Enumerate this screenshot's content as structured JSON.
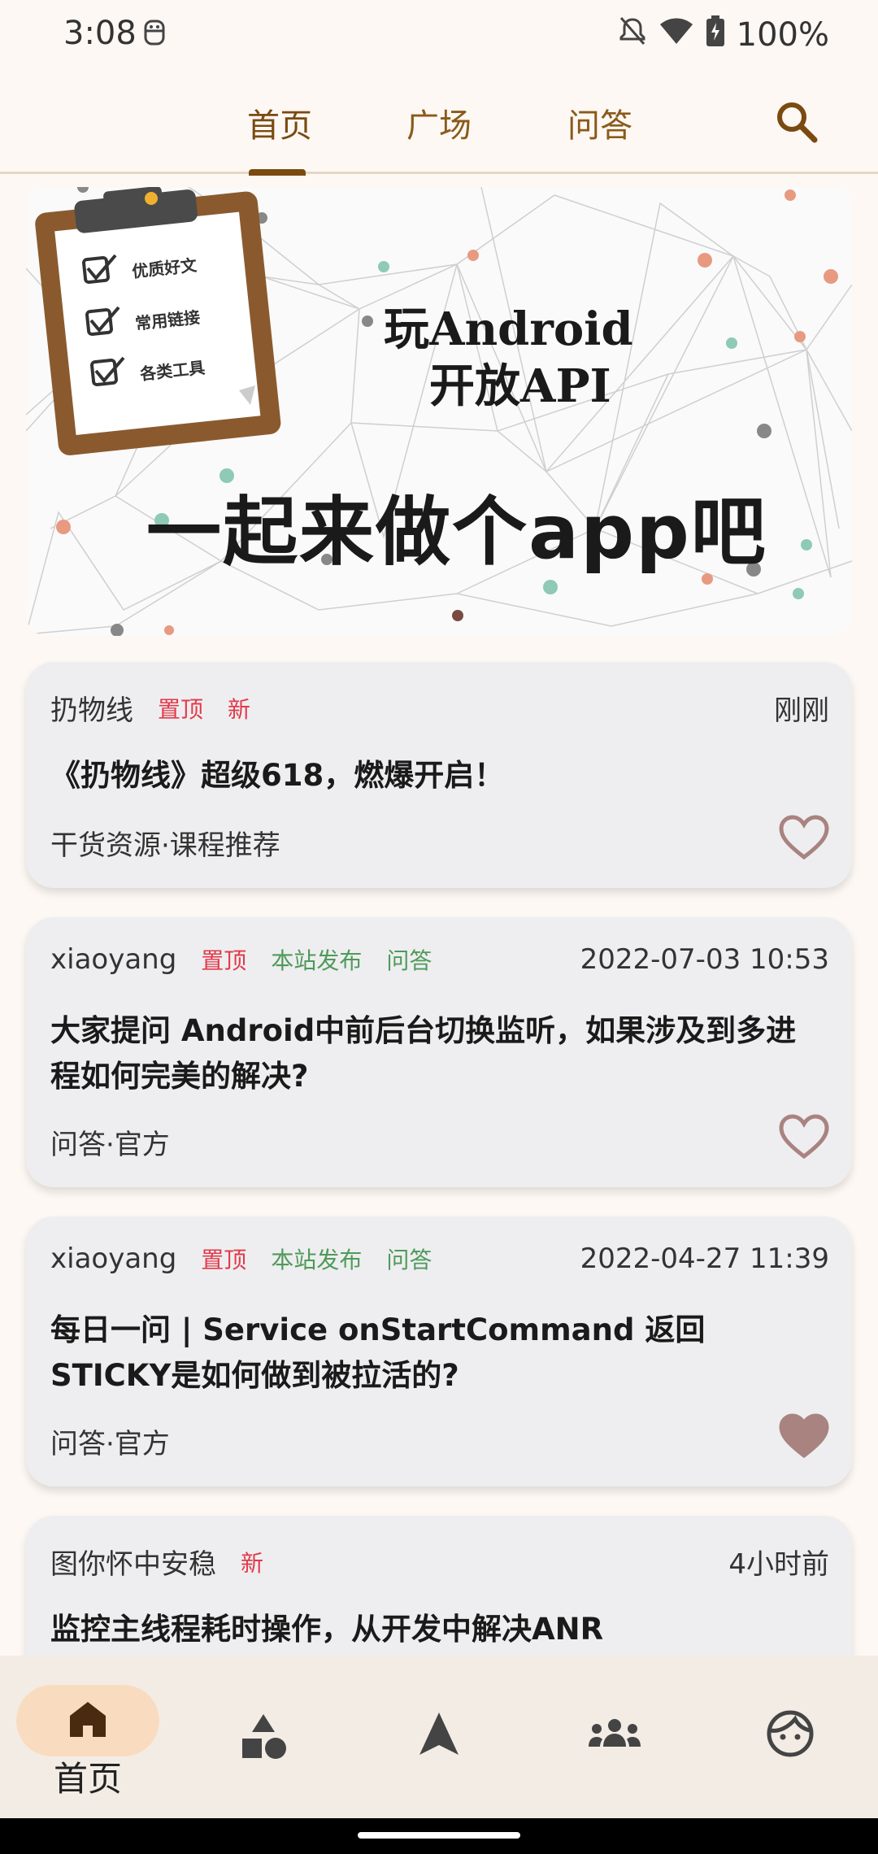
{
  "status": {
    "time": "3:08",
    "battery": "100%"
  },
  "tabs": [
    {
      "label": "首页",
      "active": true
    },
    {
      "label": "广场",
      "active": false
    },
    {
      "label": "问答",
      "active": false
    }
  ],
  "banner": {
    "line1": "玩Android",
    "line2": "开放API",
    "slogan": "一起来做个app吧",
    "clipboard": [
      "优质好文",
      "常用链接",
      "各类工具"
    ]
  },
  "cards": [
    {
      "author": "扔物线",
      "tags": [
        {
          "text": "置顶",
          "color": "red"
        },
        {
          "text": "新",
          "color": "red"
        }
      ],
      "time": "刚刚",
      "title": "《扔物线》超级618，燃爆开启！",
      "chapter": "干货资源·课程推荐",
      "liked": false
    },
    {
      "author": "xiaoyang",
      "tags": [
        {
          "text": "置顶",
          "color": "red"
        },
        {
          "text": "本站发布",
          "color": "green"
        },
        {
          "text": "问答",
          "color": "green"
        }
      ],
      "time": "2022-07-03 10:53",
      "title": "大家提问 Android中前后台切换监听，如果涉及到多进程如何完美的解决?",
      "chapter": "问答·官方",
      "liked": false
    },
    {
      "author": "xiaoyang",
      "tags": [
        {
          "text": "置顶",
          "color": "red"
        },
        {
          "text": "本站发布",
          "color": "green"
        },
        {
          "text": "问答",
          "color": "green"
        }
      ],
      "time": "2022-04-27 11:39",
      "title": "每日一问 | Service onStartCommand 返回STICKY是如何做到被拉活的?",
      "chapter": "问答·官方",
      "liked": true
    },
    {
      "author": "图你怀中安稳",
      "tags": [
        {
          "text": "新",
          "color": "red"
        }
      ],
      "time": "4小时前",
      "title": "监控主线程耗时操作，从开发中解决ANR",
      "chapter": "",
      "liked": false
    }
  ],
  "bottom_nav": [
    {
      "label": "首页",
      "icon": "home-icon",
      "active": true
    },
    {
      "label": "",
      "icon": "shapes-icon",
      "active": false
    },
    {
      "label": "",
      "icon": "navigation-icon",
      "active": false
    },
    {
      "label": "",
      "icon": "groups-icon",
      "active": false
    },
    {
      "label": "",
      "icon": "face-icon",
      "active": false
    }
  ],
  "colors": {
    "accent": "#7a4a10",
    "tag_red": "#e23a4a",
    "tag_green": "#4f9a5a",
    "heart": "#a98380"
  }
}
